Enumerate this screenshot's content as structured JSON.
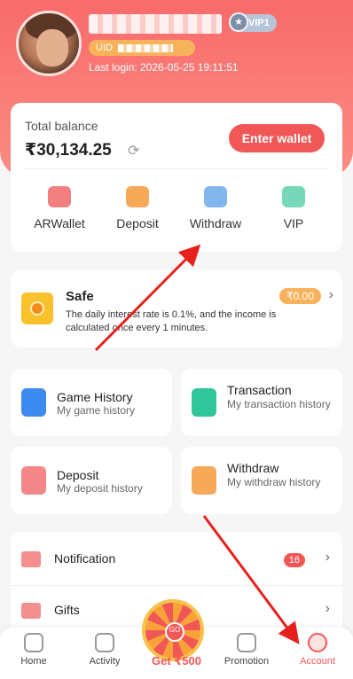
{
  "header": {
    "vip_label": "VIP1",
    "uid_label": "UID",
    "last_login": "Last login: 2026-05-25 19:11:51"
  },
  "balance": {
    "label": "Total balance",
    "amount": "₹30,134.25",
    "enter_wallet": "Enter wallet",
    "shortcuts": [
      {
        "label": "ARWallet",
        "color": "#f0696a"
      },
      {
        "label": "Deposit",
        "color": "#f59a3a"
      },
      {
        "label": "Withdraw",
        "color": "#5b9de8"
      },
      {
        "label": "VIP",
        "color": "#4bc9a0"
      }
    ]
  },
  "safe": {
    "title": "Safe",
    "amount": "₹0.00",
    "description": "The daily interest rate is 0.1%, and the income is calculated once every 1 minutes."
  },
  "tiles": [
    {
      "title": "Game History",
      "subtitle": "My game history",
      "icon": "game-history-icon",
      "color": "#3d8bf0"
    },
    {
      "title": "Transaction",
      "subtitle": "My transaction history",
      "icon": "transaction-icon",
      "color": "#2fc69a"
    },
    {
      "title": "Deposit",
      "subtitle": "My deposit history",
      "icon": "deposit-history-icon",
      "color": "#f0696a"
    },
    {
      "title": "Withdraw",
      "subtitle": "My withdraw history",
      "icon": "withdraw-history-icon",
      "color": "#f59a3a"
    }
  ],
  "list": [
    {
      "label": "Notification",
      "badge": "16",
      "icon": "mail-icon",
      "color": "#f0696a"
    },
    {
      "label": "Gifts",
      "icon": "gift-icon",
      "color": "#f0696a"
    }
  ],
  "nav": {
    "items": [
      {
        "label": "Home"
      },
      {
        "label": "Activity"
      },
      {
        "label": "Promotion"
      },
      {
        "label": "Account"
      }
    ],
    "wheel_label": "Get ₹500",
    "wheel_hub": "GO"
  },
  "colors": {
    "accent": "#f25757",
    "header": "#f86b6b",
    "arrow": "#e8201c"
  }
}
